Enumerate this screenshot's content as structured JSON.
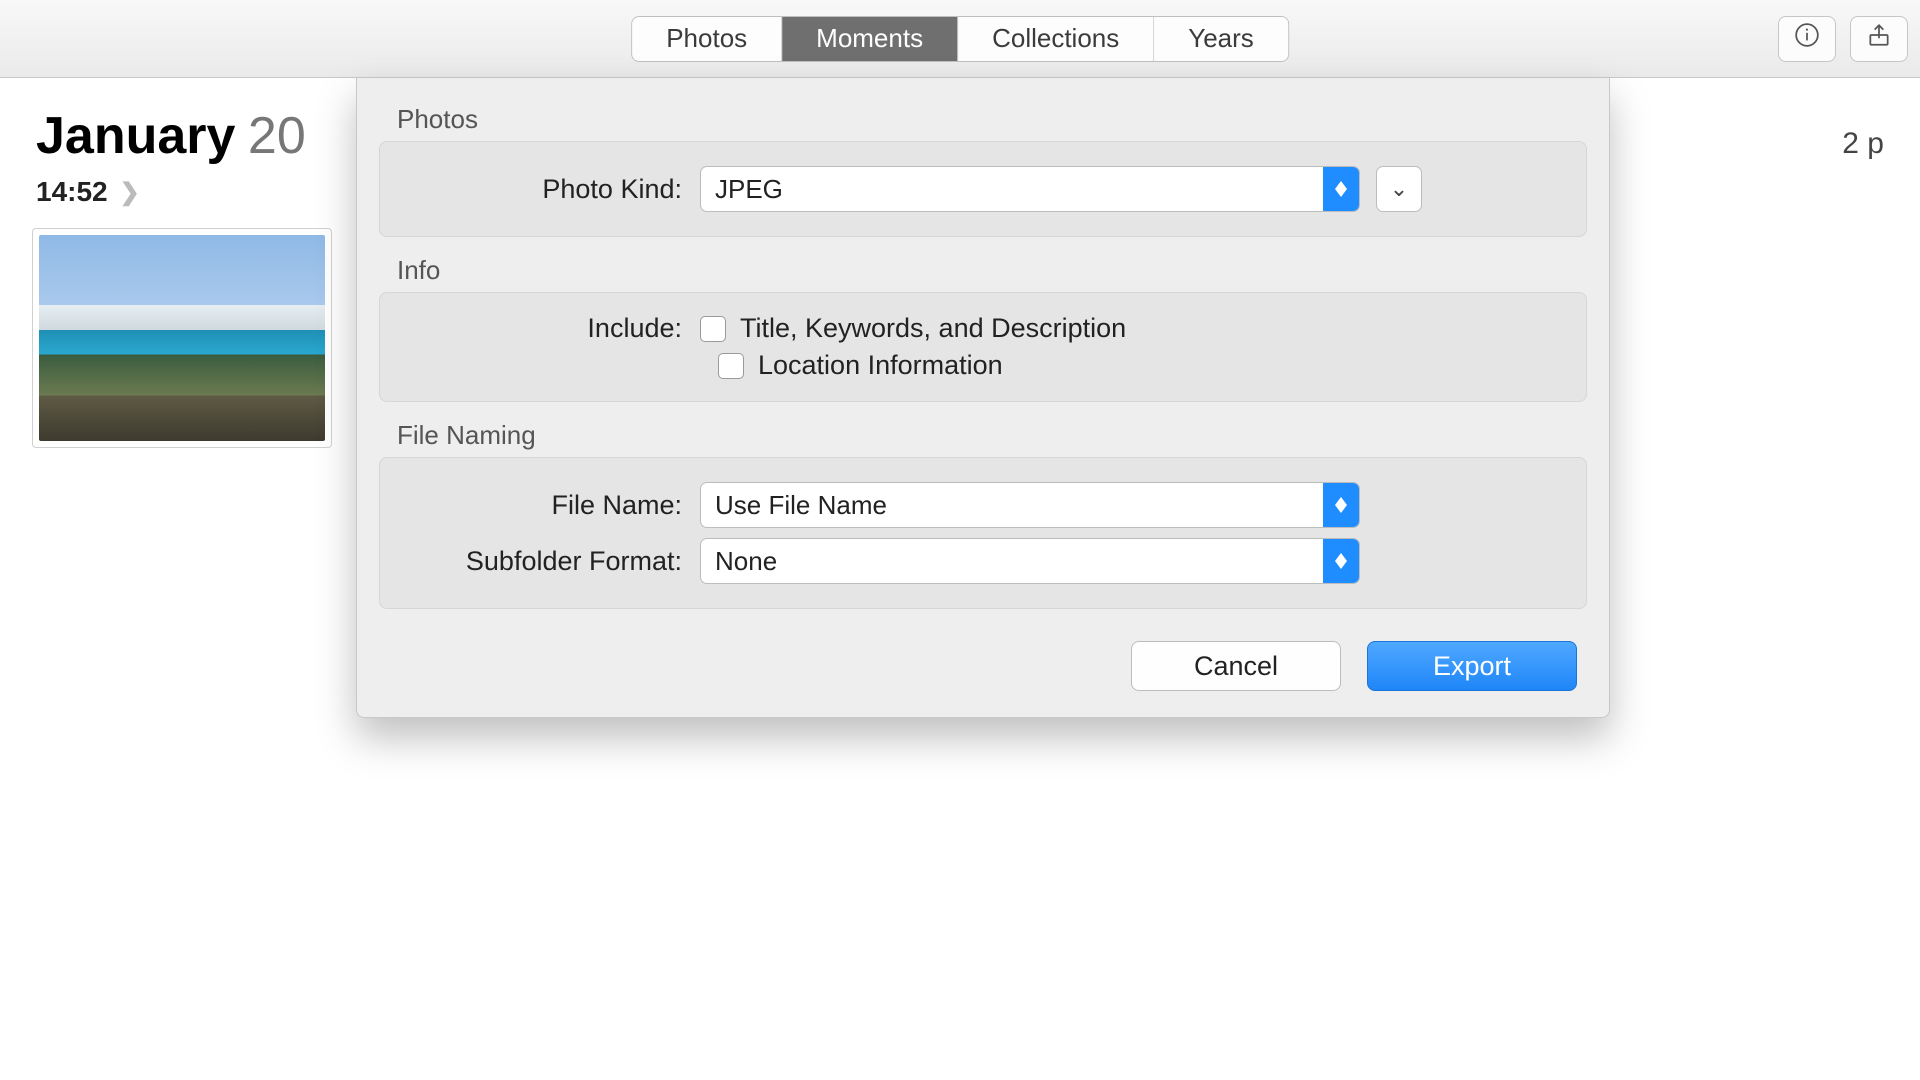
{
  "toolbar": {
    "segments": [
      "Photos",
      "Moments",
      "Collections",
      "Years"
    ],
    "active_index": 1
  },
  "header": {
    "month": "January",
    "year": "20",
    "count": "2 p",
    "time": "14:52"
  },
  "dialog": {
    "sections": {
      "photos": {
        "label": "Photos",
        "photo_kind_label": "Photo Kind:",
        "photo_kind_value": "JPEG"
      },
      "info": {
        "label": "Info",
        "include_label": "Include:",
        "cb1": "Title, Keywords, and Description",
        "cb2": "Location Information"
      },
      "file_naming": {
        "label": "File Naming",
        "file_name_label": "File Name:",
        "file_name_value": "Use File Name",
        "subfolder_label": "Subfolder Format:",
        "subfolder_value": "None"
      }
    },
    "buttons": {
      "cancel": "Cancel",
      "export": "Export"
    }
  }
}
